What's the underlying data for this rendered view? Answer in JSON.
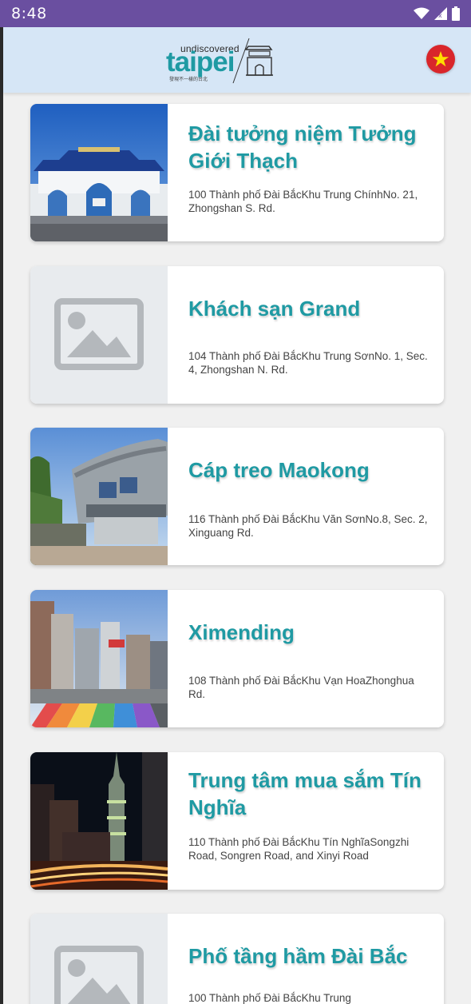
{
  "status_bar": {
    "time": "8:48"
  },
  "header": {
    "logo": {
      "small_text": "undiscovered",
      "big_text": "taipei",
      "tiny_text": "發現不一樣的台北"
    },
    "language_flag": "vietnam-flag-icon"
  },
  "places": [
    {
      "title": "Đài tưởng niệm Tưởng Giới Thạch",
      "address": "100 Thành phố Đài BắcKhu Trung ChínhNo. 21, Zhongshan S. Rd.",
      "image": "memorial-photo"
    },
    {
      "title": "Khách sạn Grand",
      "address": "104 Thành phố Đài BắcKhu Trung SơnNo. 1, Sec. 4, Zhongshan N. Rd.",
      "image": "placeholder-image-icon"
    },
    {
      "title": "Cáp treo Maokong",
      "address": "116 Thành phố Đài BắcKhu Văn SơnNo.8, Sec. 2, Xinguang Rd.",
      "image": "gondola-station-photo"
    },
    {
      "title": "Ximending",
      "address": "108 Thành phố Đài BắcKhu Vạn HoaZhonghua Rd.",
      "image": "ximending-street-photo"
    },
    {
      "title": "Trung tâm mua sắm Tín Nghĩa",
      "address": "110 Thành phố Đài BắcKhu Tín NghĩaSongzhi Road, Songren Road, and Xinyi Road",
      "image": "taipei101-night-photo"
    },
    {
      "title": "Phố tầng hầm Đài Bắc",
      "address": "100 Thành phố Đài BắcKhu Trung",
      "image": "placeholder-image-icon"
    }
  ],
  "colors": {
    "status_bar": "#6a4fa0",
    "header": "#d6e6f6",
    "accent": "#1f9aa3"
  }
}
